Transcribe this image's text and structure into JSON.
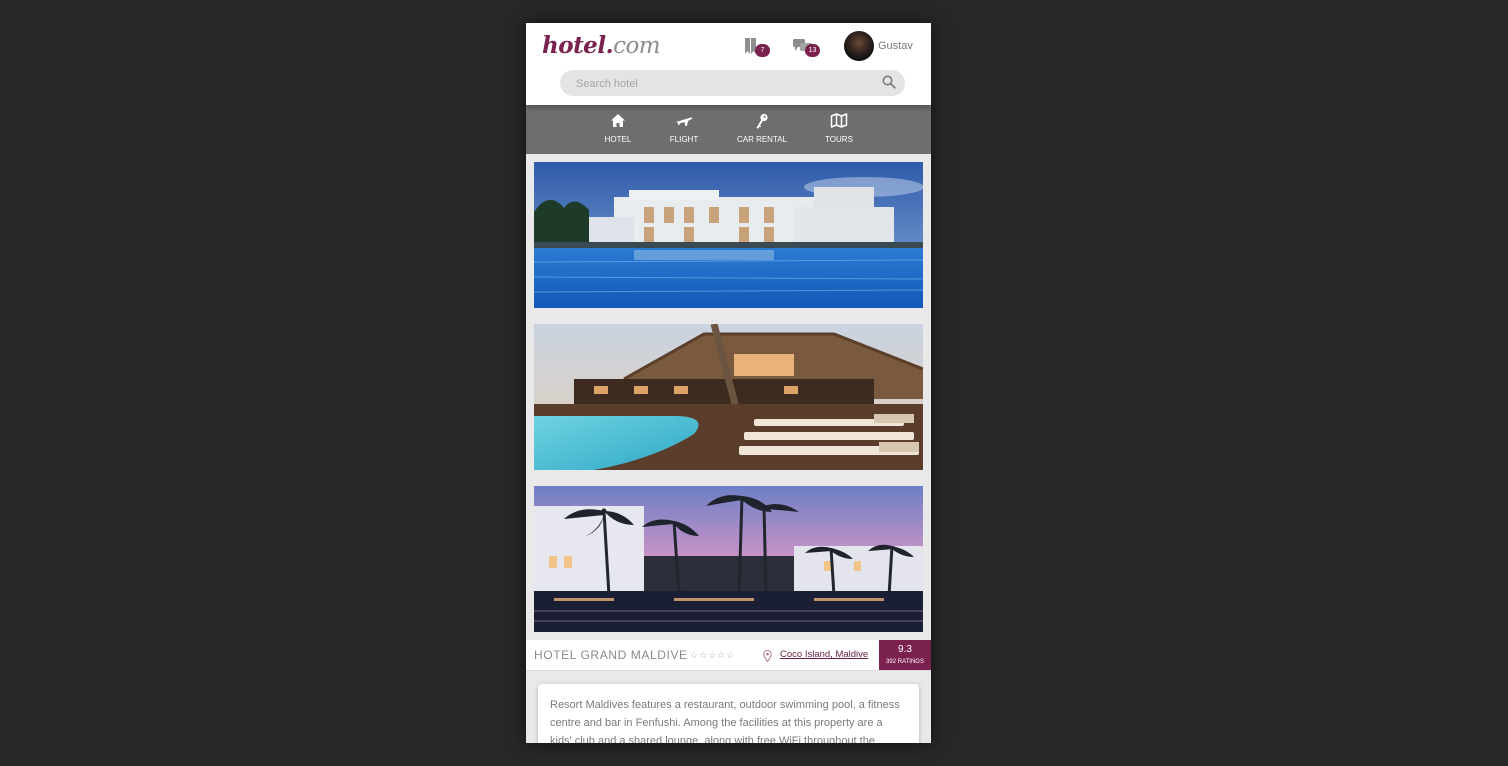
{
  "header": {
    "logo_main": "hotel",
    "logo_dot": ".",
    "logo_com": "com",
    "bookmarks_badge": "7",
    "messages_badge": "13",
    "user_name": "Gustav"
  },
  "search": {
    "placeholder": "Search hotel"
  },
  "nav": {
    "items": [
      {
        "label": "HOTEL",
        "icon": "home-icon"
      },
      {
        "label": "FLIGHT",
        "icon": "airplane-icon"
      },
      {
        "label": "CAR RENTAL",
        "icon": "key-icon"
      },
      {
        "label": "TOURS",
        "icon": "map-icon"
      }
    ]
  },
  "hotel": {
    "name": "HOTEL GRAND MALDIVE",
    "stars": "☆☆☆☆☆",
    "location": "Coco Island, Maldive",
    "score": "9.3",
    "ratings": "392 RATINGS",
    "description": "Resort Maldives features a restaurant, outdoor swimming pool, a fitness centre and bar in Fenfushi. Among the facilities at this property are a kids' club and a shared lounge, along with free WiFi throughout the property."
  },
  "colors": {
    "accent": "#7a2150",
    "nav_bg": "#6e6e6e",
    "page_bg": "#282828"
  }
}
